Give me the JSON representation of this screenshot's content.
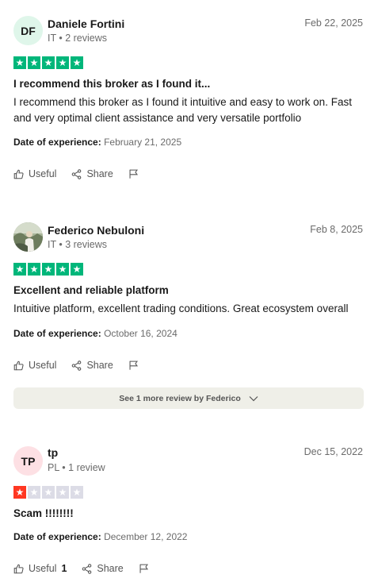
{
  "reviews": [
    {
      "initials": "DF",
      "avatar_color": "#dff6ea",
      "name": "Daniele Fortini",
      "meta": "IT • 2 reviews",
      "date": "Feb 22, 2025",
      "rating": 5,
      "title": "I recommend this broker as I found it...",
      "body": "I recommend this broker as I found it intuitive and easy to work on. Fast and very optimal client assistance and very versatile portfolio",
      "exp_label": "Date of experience:",
      "exp_date": "February 21, 2025",
      "useful_label": "Useful",
      "share_label": "Share"
    },
    {
      "initials": "",
      "avatar_color": "",
      "name": "Federico Nebuloni",
      "meta": "IT • 3 reviews",
      "date": "Feb 8, 2025",
      "rating": 5,
      "title": "Excellent and reliable platform",
      "body": "Intuitive platform, excellent trading conditions. Great ecosystem overall",
      "exp_label": "Date of experience:",
      "exp_date": "October 16, 2024",
      "useful_label": "Useful",
      "share_label": "Share",
      "more_label": "See 1 more review by Federico"
    },
    {
      "initials": "TP",
      "avatar_color": "#fde0e4",
      "name": "tp",
      "meta": "PL • 1 review",
      "date": "Dec 15, 2022",
      "rating": 1,
      "title": "Scam !!!!!!!!",
      "body": "",
      "exp_label": "Date of experience:",
      "exp_date": "December 12, 2022",
      "useful_label": "Useful",
      "useful_count": "1",
      "share_label": "Share"
    }
  ],
  "colors": {
    "star_green": "#00b67a",
    "star_red": "#ff3722",
    "star_empty": "#dcdce6"
  }
}
